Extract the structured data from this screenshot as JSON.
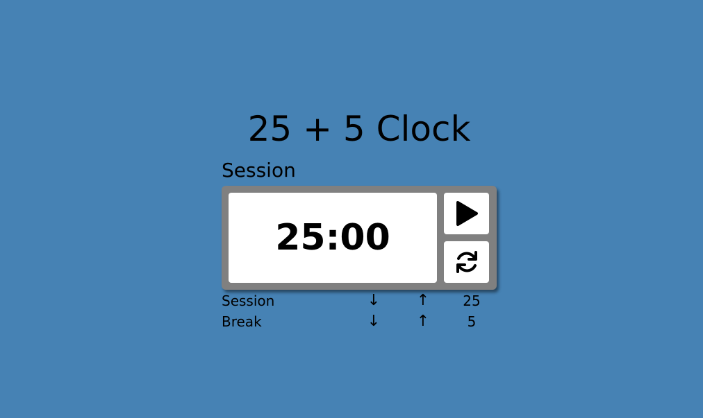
{
  "app": {
    "title": "25 + 5 Clock"
  },
  "timer": {
    "label": "Session",
    "time": "25:00",
    "play_icon": "play-icon",
    "reset_icon": "refresh-icon"
  },
  "settings": [
    {
      "name": "Session",
      "down": "↓",
      "up": "↑",
      "value": "25"
    },
    {
      "name": "Break",
      "down": "↓",
      "up": "↑",
      "value": "5"
    }
  ],
  "colors": {
    "background": "#4682b4",
    "timer_frame": "#808080",
    "panel": "#ffffff"
  }
}
